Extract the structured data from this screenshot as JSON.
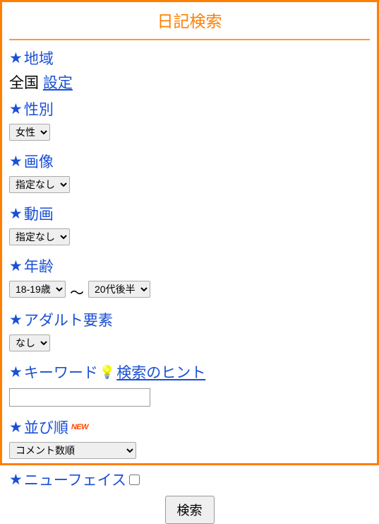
{
  "title": "日記検索",
  "region": {
    "label": "地域",
    "value": "全国",
    "settings_link": "設定"
  },
  "gender": {
    "label": "性別",
    "selected": "女性"
  },
  "image": {
    "label": "画像",
    "selected": "指定なし"
  },
  "video": {
    "label": "動画",
    "selected": "指定なし"
  },
  "age": {
    "label": "年齢",
    "from": "18-19歳",
    "separator": "〜",
    "to": "20代後半"
  },
  "adult": {
    "label": "アダルト要素",
    "selected": "なし"
  },
  "keyword": {
    "label": "キーワード",
    "hint_link": "検索のヒント",
    "value": ""
  },
  "sort": {
    "label": "並び順",
    "new_badge": "NEW",
    "selected": "コメント数順"
  },
  "newface": {
    "label": "ニューフェイス",
    "checked": false
  },
  "submit": "検索",
  "star": "★"
}
